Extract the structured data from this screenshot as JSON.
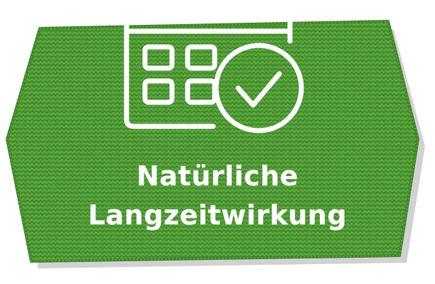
{
  "badge": {
    "line1": "Natürliche",
    "line2": "Langzeitwirkung",
    "icon": "calendar-check-icon"
  },
  "colors": {
    "felt_green": "#4f9a35",
    "felt_dark": "#3a7a25",
    "felt_light": "#6bb34e",
    "ink": "#ffffff"
  }
}
